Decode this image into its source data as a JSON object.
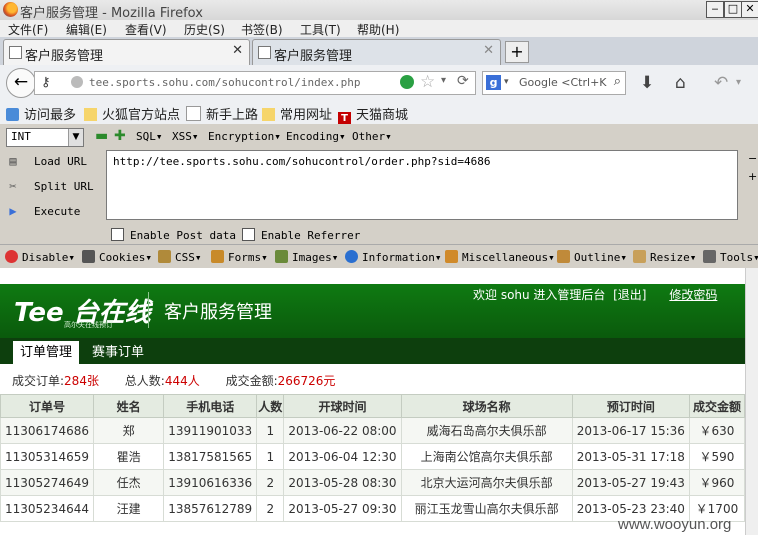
{
  "window": {
    "title": "客户服务管理 - Mozilla Firefox"
  },
  "menu": [
    "文件(F)",
    "编辑(E)",
    "查看(V)",
    "历史(S)",
    "书签(B)",
    "工具(T)",
    "帮助(H)"
  ],
  "tabs": [
    {
      "label": "客户服务管理"
    },
    {
      "label": "客户服务管理"
    }
  ],
  "nav": {
    "url": "tee.sports.sohu.com/sohucontrol/index.php",
    "search_placeholder": "Google <Ctrl+K"
  },
  "bookmarks": [
    "访问最多",
    "火狐官方站点",
    "新手上路",
    "常用网址",
    "天猫商城"
  ],
  "hackbar": {
    "select_value": "INT",
    "menus": [
      "SQL",
      "XSS",
      "Encryption",
      "Encoding",
      "Other"
    ],
    "load_url": "Load URL",
    "split_url": "Split URL",
    "execute": "Execute",
    "url_text": "http://tee.sports.sohu.com/sohucontrol/order.php?sid=4686",
    "enable_post": "Enable Post data",
    "enable_referrer": "Enable Referrer"
  },
  "webdev": [
    "Disable",
    "Cookies",
    "CSS",
    "Forms",
    "Images",
    "Information",
    "Miscellaneous",
    "Outline",
    "Resize",
    "Tools"
  ],
  "site": {
    "logo": "Tee 台在线",
    "logo_sub": "高尔夫在线预订",
    "title": "客户服务管理",
    "welcome": "欢迎 sohu 进入管理后台",
    "logout": "[退出]",
    "change_password": "修改密码",
    "tabs": [
      "订单管理",
      "赛事订单"
    ],
    "stats": {
      "orders_label": "成交订单:",
      "orders_value": "284张",
      "people_label": "总人数:",
      "people_value": "444人",
      "amount_label": "成交金额:",
      "amount_value": "266726元"
    },
    "table": {
      "headers": [
        "订单号",
        "姓名",
        "手机电话",
        "人数",
        "开球时间",
        "球场名称",
        "预订时间",
        "成交金额"
      ],
      "rows": [
        [
          "11306174686",
          "郑",
          "13911901033",
          "1",
          "2013-06-22 08:00",
          "威海石岛高尔夫俱乐部",
          "2013-06-17 15:36",
          "￥630"
        ],
        [
          "11305314659",
          "瞿浩",
          "13817581565",
          "1",
          "2013-06-04 12:30",
          "上海南公馆高尔夫俱乐部",
          "2013-05-31 17:18",
          "￥590"
        ],
        [
          "11305274649",
          "任杰",
          "13910616336",
          "2",
          "2013-05-28 08:30",
          "北京大运河高尔夫俱乐部",
          "2013-05-27 19:43",
          "￥960"
        ],
        [
          "11305234644",
          "汪建",
          "13857612789",
          "2",
          "2013-05-27 09:30",
          "丽江玉龙雪山高尔夫俱乐部",
          "2013-05-23 23:40",
          "￥1700"
        ]
      ]
    }
  },
  "watermark": "www.wooyun.org"
}
